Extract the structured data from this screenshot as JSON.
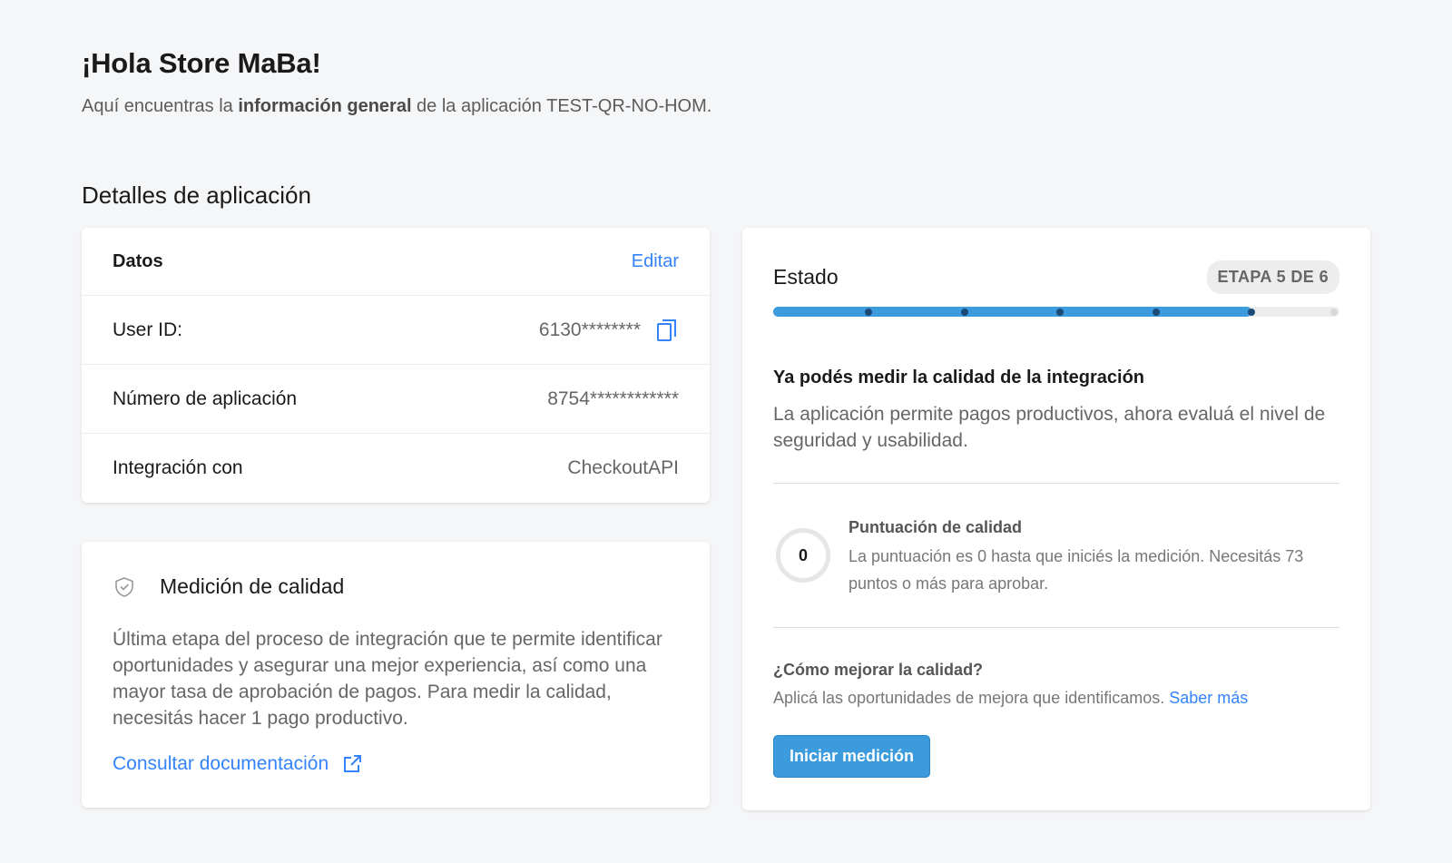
{
  "header": {
    "greeting": "¡Hola Store MaBa!",
    "subtitle_pre": "Aquí encuentras la ",
    "subtitle_bold": "información general",
    "subtitle_post": " de la aplicación TEST-QR-NO-HOM."
  },
  "section_title": "Detalles de aplicación",
  "datos": {
    "title": "Datos",
    "edit_label": "Editar",
    "rows": [
      {
        "label": "User ID:",
        "value": "6130********"
      },
      {
        "label": "Número de aplicación",
        "value": "8754************"
      },
      {
        "label": "Integración con",
        "value": "CheckoutAPI"
      }
    ]
  },
  "medicion": {
    "icon": "shield-check-icon",
    "title": "Medición de calidad",
    "text": "Última etapa del proceso de integración que te permite identificar oportunidades y asegurar una mejor experiencia, así como una mayor tasa de aprobación de pagos. Para medir la calidad, necesitás hacer 1 pago productivo.",
    "doc_link": "Consultar documentación"
  },
  "estado": {
    "title": "Estado",
    "stage_badge": "ETAPA 5 DE 6",
    "progress": {
      "current": 5,
      "total": 6,
      "fill_fraction": 0.845
    },
    "heading": "Ya podés medir la calidad de la integración",
    "description": "La aplicación permite pagos productivos, ahora evaluá el nivel de seguridad y usabilidad.",
    "score": {
      "value": "0",
      "title": "Puntuación de calidad",
      "text": "La puntuación es 0 hasta que iniciés la medición. Necesitás 73 puntos o más para aprobar."
    },
    "improve": {
      "title": "¿Cómo mejorar la calidad?",
      "text": "Aplicá las oportunidades de mejora que identificamos. ",
      "link": "Saber más"
    },
    "button": "Iniciar medición"
  },
  "colors": {
    "accent": "#3483fa",
    "progress": "#3c9bdc",
    "background": "#f5f6f8"
  }
}
